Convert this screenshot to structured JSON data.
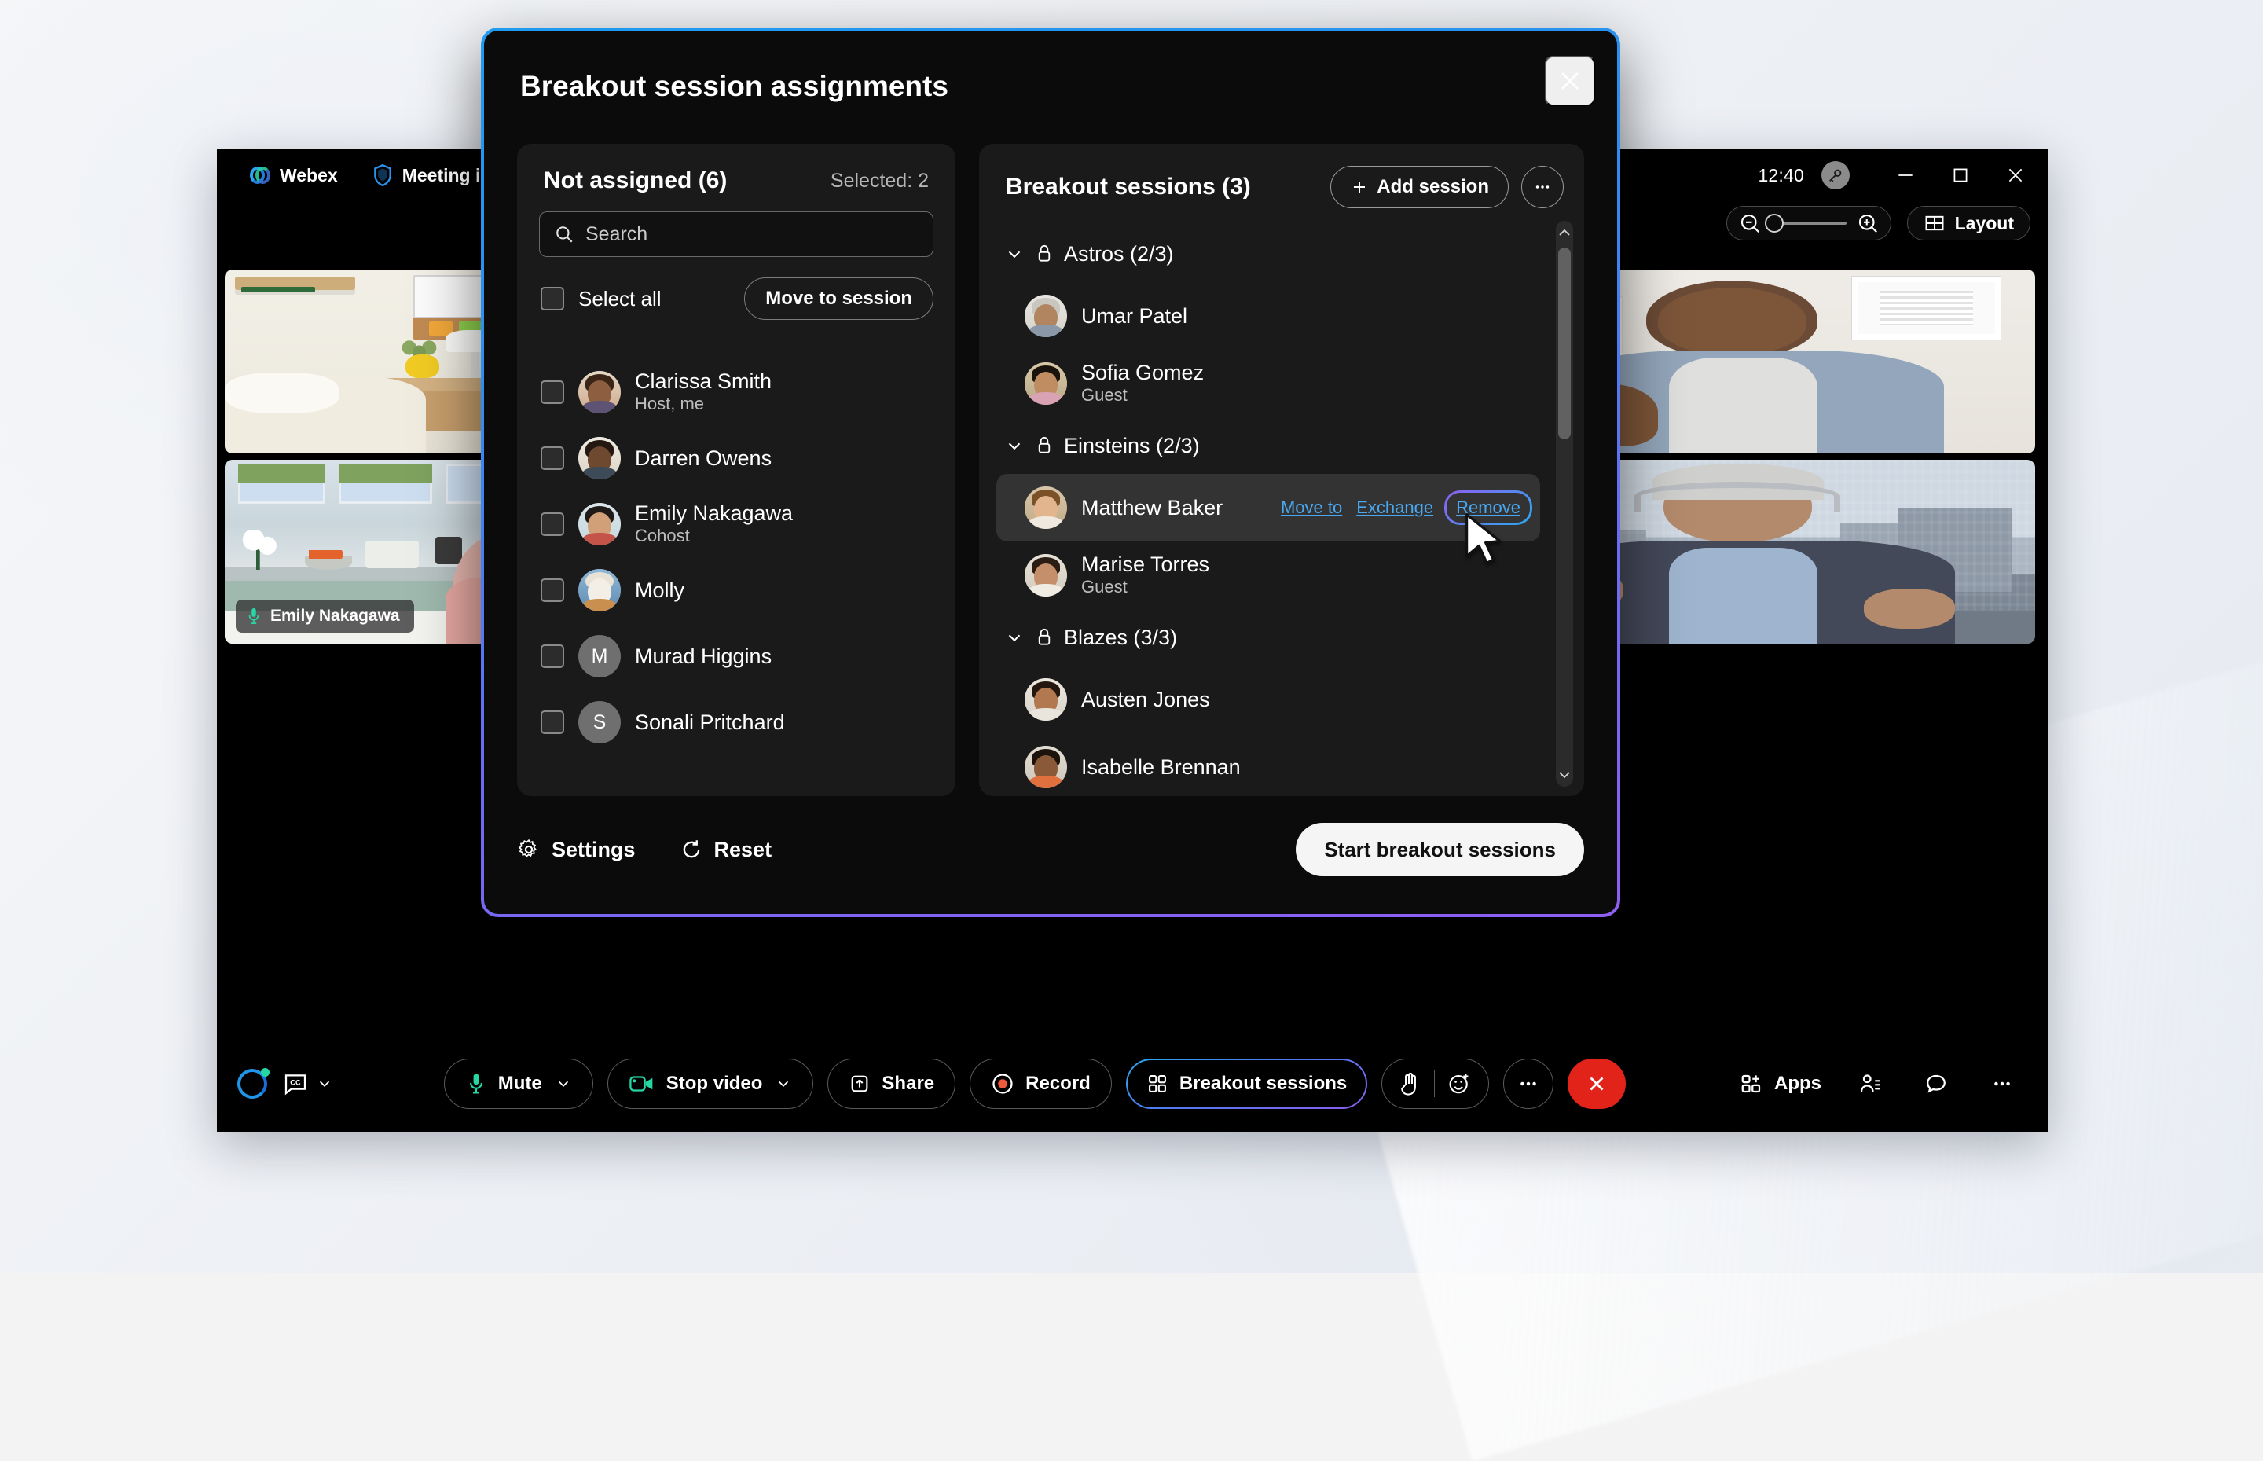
{
  "desktop": {
    "name": "windows-desktop"
  },
  "window": {
    "titlebar": {
      "app_name": "Webex",
      "meeting_info": "Meeting info",
      "clock": "12:40",
      "minimize": "Minimize",
      "maximize": "Maximize",
      "close": "Close"
    },
    "subbar": {
      "zoom_out": "Zoom out",
      "zoom_in": "Zoom in",
      "layout_label": "Layout"
    }
  },
  "stage": {
    "tiles": [
      {
        "name": "tile-bedroom",
        "label": "",
        "art": "bedroom",
        "speaking": false,
        "muted": false
      },
      {
        "name": "tile-emily",
        "label": "Emily Nakagawa",
        "art": "kitchen",
        "speaking": true,
        "muted": false
      },
      {
        "name": "tile-hands",
        "label": "",
        "art": "hands",
        "speaking": false,
        "muted": true
      },
      {
        "name": "tile-thumbsup",
        "label": "",
        "art": "office",
        "speaking": false,
        "muted": false
      },
      {
        "name": "tile-waving",
        "label": "",
        "art": "city",
        "speaking": false,
        "muted": false
      }
    ]
  },
  "controlbar": {
    "captions_label": "Closed captions",
    "mute_label": "Mute",
    "video_label": "Stop video",
    "share_label": "Share",
    "record_label": "Record",
    "breakout_label": "Breakout sessions",
    "reactions_hand": "Raise hand",
    "reactions_emoji": "Reactions",
    "more_options": "More options",
    "leave_label": "Leave meeting",
    "apps_label": "Apps",
    "participants_label": "Participants",
    "chat_label": "Chat",
    "more_label": "More"
  },
  "dialog": {
    "title": "Breakout session assignments",
    "close_label": "Close",
    "not_assigned": {
      "title": "Not assigned (6)",
      "selected": "Selected: 2",
      "search_placeholder": "Search",
      "search_value": "",
      "select_all_label": "Select all",
      "move_to_session_label": "Move to session",
      "participants": [
        {
          "name": "Clarissa Smith",
          "role": "Host, me",
          "avatar": "photo-clarissa",
          "initial": ""
        },
        {
          "name": "Darren Owens",
          "role": "",
          "avatar": "photo-darren",
          "initial": ""
        },
        {
          "name": "Emily Nakagawa",
          "role": "Cohost",
          "avatar": "photo-emily",
          "initial": ""
        },
        {
          "name": "Molly",
          "role": "",
          "avatar": "photo-molly",
          "initial": ""
        },
        {
          "name": "Murad Higgins",
          "role": "",
          "avatar": "initials",
          "initial": "M"
        },
        {
          "name": "Sonali Pritchard",
          "role": "",
          "avatar": "initials",
          "initial": "S"
        }
      ]
    },
    "sessions_panel": {
      "title": "Breakout sessions (3)",
      "add_session_label": "Add session",
      "more_label": "More options",
      "row_actions": {
        "move_to": "Move to",
        "exchange": "Exchange",
        "remove": "Remove"
      },
      "sessions": [
        {
          "name": "Astros (2/3)",
          "locked": true,
          "expanded": true,
          "members": [
            {
              "name": "Umar Patel",
              "role": "",
              "avatar": "photo-umar"
            },
            {
              "name": "Sofia Gomez",
              "role": "Guest",
              "avatar": "photo-sofia"
            }
          ]
        },
        {
          "name": "Einsteins (2/3)",
          "locked": true,
          "expanded": true,
          "members": [
            {
              "name": "Matthew Baker",
              "role": "",
              "avatar": "photo-matthew",
              "hovered": true
            },
            {
              "name": "Marise Torres",
              "role": "Guest",
              "avatar": "photo-marise"
            }
          ]
        },
        {
          "name": "Blazes (3/3)",
          "locked": true,
          "expanded": true,
          "members": [
            {
              "name": "Austen Jones",
              "role": "",
              "avatar": "photo-austen"
            },
            {
              "name": "Isabelle Brennan",
              "role": "",
              "avatar": "photo-isabelle"
            }
          ]
        }
      ]
    },
    "footer": {
      "settings_label": "Settings",
      "reset_label": "Reset",
      "start_label": "Start breakout sessions"
    }
  },
  "colors": {
    "dialog_border_from": "#1f9bf0",
    "dialog_border_to": "#8e5ff0",
    "link_blue": "#4aa8f0",
    "speaking_teal": "#1ec8a5",
    "leave_red": "#e2231a",
    "mute_red": "#e8556a",
    "mic_teal": "#26d6a4",
    "record_orange": "#f05a3c"
  }
}
